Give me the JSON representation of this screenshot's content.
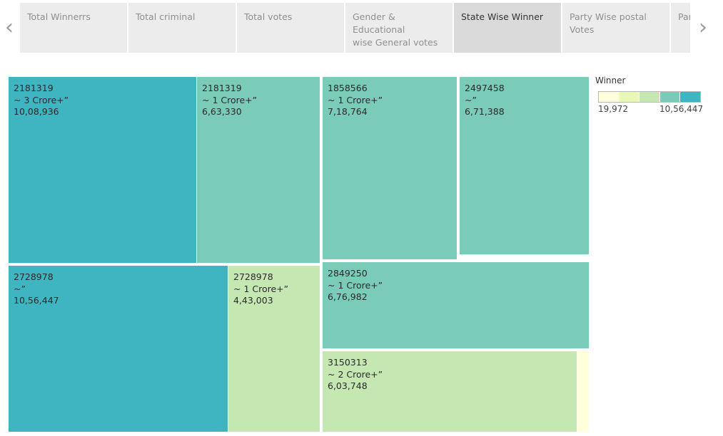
{
  "tabs": [
    {
      "lines": [
        "Total Winnerrs"
      ],
      "active": false
    },
    {
      "lines": [
        "Total criminal"
      ],
      "active": false
    },
    {
      "lines": [
        "Total votes"
      ],
      "active": false
    },
    {
      "lines": [
        "Gender & Educational",
        "wise General votes"
      ],
      "active": false
    },
    {
      "lines": [
        "State Wise Winner"
      ],
      "active": true
    },
    {
      "lines": [
        "Party Wise postal",
        "Votes"
      ],
      "active": false
    },
    {
      "lines": [
        "Par"
      ],
      "active": false
    }
  ],
  "nav": {
    "prev_icon": "chevron-left-icon",
    "next_icon": "chevron-right-icon"
  },
  "colors": {
    "c5": "#40b5c2",
    "c4": "#7bcbb9",
    "c3": "#c5e8b3",
    "c2": "#e9f7b7",
    "c1": "#ffffda",
    "tab_bg": "#ececec",
    "tab_active_bg": "#dadada"
  },
  "tiles": [
    {
      "lines": [
        "2181319",
        "~ 3 Crore+”",
        "10,08,936"
      ],
      "color": "c5"
    },
    {
      "lines": [
        "2181319",
        "~ 1 Crore+”",
        "6,63,330"
      ],
      "color": "c4"
    },
    {
      "lines": [
        "1858566",
        "~ 1 Crore+”",
        "7,18,764"
      ],
      "color": "c4"
    },
    {
      "lines": [
        "2497458",
        "~”",
        "6,71,388"
      ],
      "color": "c4"
    },
    {
      "lines": [
        "2728978",
        "~”",
        "10,56,447"
      ],
      "color": "c5"
    },
    {
      "lines": [
        "2728978",
        "~ 1 Crore+”",
        "4,43,003"
      ],
      "color": "c3"
    },
    {
      "lines": [
        "2849250",
        "~ 1 Crore+”",
        "6,76,982"
      ],
      "color": "c4"
    },
    {
      "lines": [
        "3150313",
        "~ 2 Crore+”",
        "6,03,748"
      ],
      "color": "c3"
    },
    {
      "lines": [],
      "color": "c1"
    }
  ],
  "legend": {
    "title": "Winner",
    "min_label": "19,972",
    "max_label": "10,56,447",
    "segments": [
      "c1",
      "c2",
      "c3",
      "c4",
      "c5"
    ]
  }
}
